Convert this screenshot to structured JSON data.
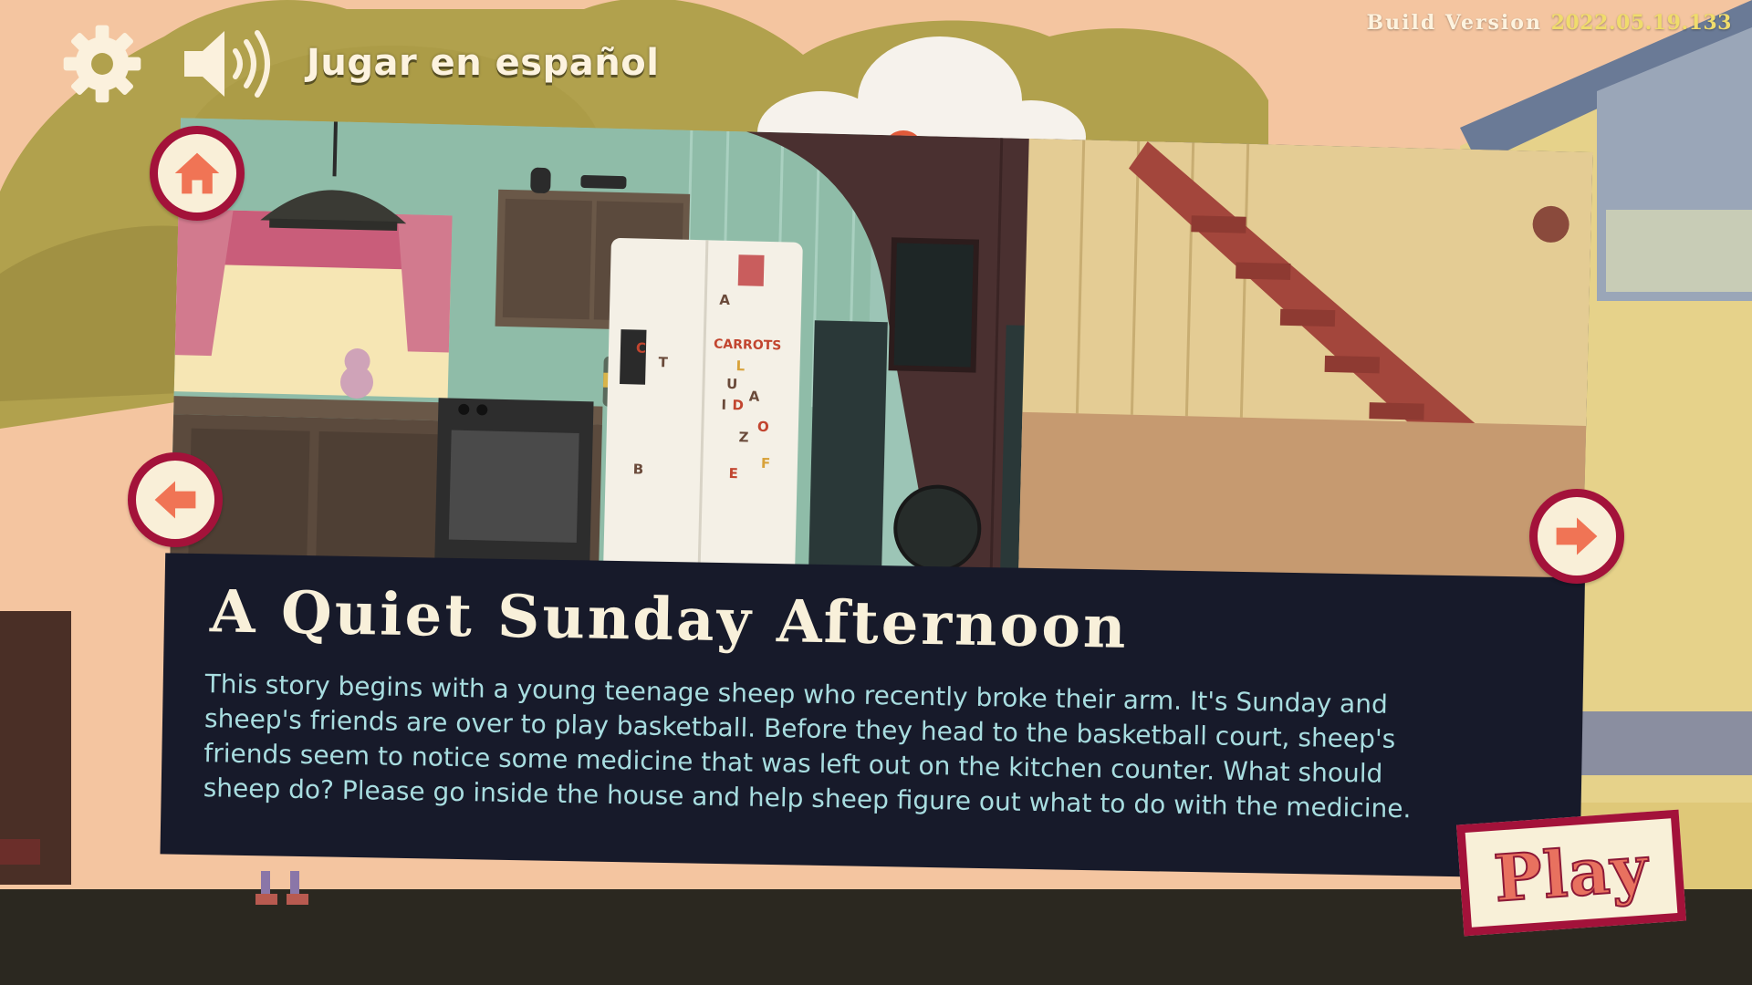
{
  "header": {
    "settings_icon": "gear-icon",
    "sound_icon": "speaker-icon",
    "language_link": "Jugar en español",
    "build_label": "Build Version",
    "build_version": "2022.05.19.133"
  },
  "story": {
    "title": "A Quiet Sunday Afternoon",
    "description": "This story begins with a young teenage sheep who recently broke their arm.  It's Sunday and sheep's friends are over to play basketball.  Before they head to the basketball court, sheep's friends seem to notice some medicine that was left out on the kitchen counter. What should sheep do? Please go inside the house and help sheep figure out what to do with the medicine."
  },
  "scene": {
    "fridge_magnets": [
      "A",
      "C",
      "T",
      "CARROTS",
      "L",
      "U",
      "I",
      "D",
      "A",
      "O",
      "Z",
      "F",
      "E",
      "B"
    ]
  },
  "navigation": {
    "home_icon": "home-icon",
    "prev_icon": "arrow-left-icon",
    "next_icon": "arrow-right-icon",
    "play_label": "Play"
  },
  "colors": {
    "accent": "#a3123a",
    "button_fill": "#f9efd8",
    "arrow": "#f07455",
    "panel": "#171a2a",
    "title_text": "#f8f0da",
    "body_text": "#a8dde0",
    "build_version": "#f0dc6c"
  }
}
